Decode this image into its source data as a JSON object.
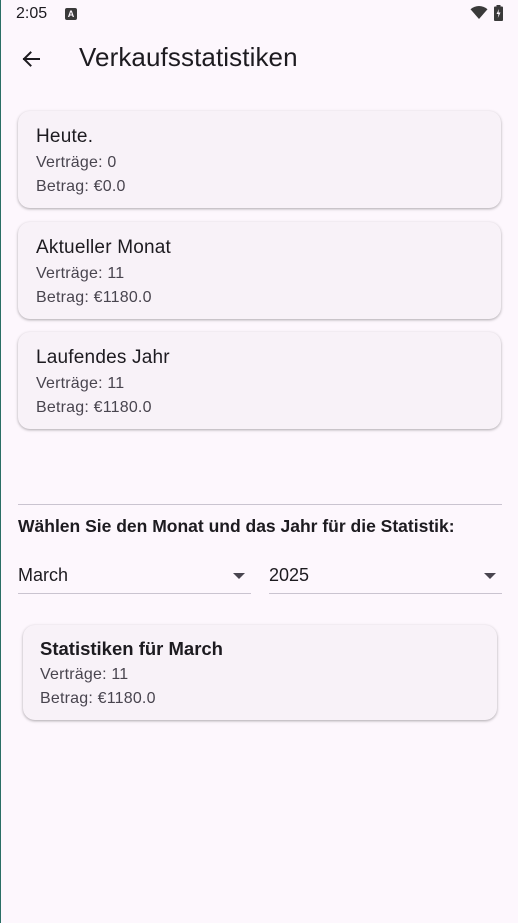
{
  "status_bar": {
    "time": "2:05",
    "notification_icon": "a-notification-icon",
    "wifi_icon": "wifi-icon",
    "battery_icon": "battery-icon"
  },
  "app_bar": {
    "back_icon": "arrow-back-icon",
    "title": "Verkaufsstatistiken"
  },
  "summary_cards": [
    {
      "title": "Heute.",
      "contracts": "Verträge: 0",
      "amount": "Betrag: €0.0"
    },
    {
      "title": "Aktueller Monat",
      "contracts": "Verträge: 11",
      "amount": "Betrag: €1180.0"
    },
    {
      "title": "Laufendes Jahr",
      "contracts": "Verträge: 11",
      "amount": "Betrag: €1180.0"
    }
  ],
  "selection": {
    "heading": "Wählen Sie den Monat und das Jahr für die Statistik:",
    "month": "March",
    "year": "2025"
  },
  "month_stats": {
    "title": "Statistiken für March",
    "contracts": "Verträge: 11",
    "amount": "Betrag: €1180.0"
  },
  "colors": {
    "background": "#fdf7fd",
    "card": "#f8f2f8",
    "text_primary": "#1d1b20",
    "text_secondary": "#49454f",
    "divider": "#cac4d0"
  }
}
